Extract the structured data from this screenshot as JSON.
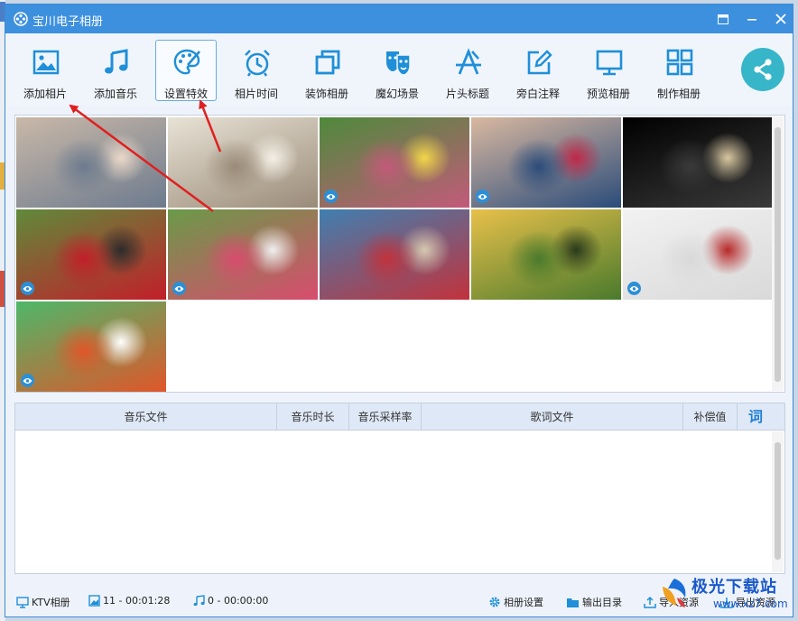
{
  "window": {
    "title": "宝川电子相册"
  },
  "toolbar": {
    "items": [
      {
        "label": "添加相片",
        "icon": "image-icon"
      },
      {
        "label": "添加音乐",
        "icon": "music-note-icon"
      },
      {
        "label": "设置特效",
        "icon": "palette-icon",
        "active": true
      },
      {
        "label": "相片时间",
        "icon": "alarm-clock-icon"
      },
      {
        "label": "装饰相册",
        "icon": "layers-icon"
      },
      {
        "label": "魔幻场景",
        "icon": "theater-mask-icon"
      },
      {
        "label": "片头标题",
        "icon": "title-a-icon"
      },
      {
        "label": "旁白注释",
        "icon": "edit-note-icon"
      },
      {
        "label": "预览相册",
        "icon": "monitor-icon"
      },
      {
        "label": "制作相册",
        "icon": "grid-icon"
      }
    ],
    "share_icon": "share-icon",
    "accent": "#1f8fd8"
  },
  "photos": {
    "count": 11,
    "items": [
      {
        "colors": [
          "#c9b8a8",
          "#6d7b8e",
          "#e9d8c8"
        ],
        "eye": false
      },
      {
        "colors": [
          "#e8e2d6",
          "#9a8b78",
          "#f4efe6"
        ],
        "eye": false
      },
      {
        "colors": [
          "#4e8a3c",
          "#c35a7a",
          "#f2d64a"
        ],
        "eye": true
      },
      {
        "colors": [
          "#d9b8a0",
          "#2b4c7a",
          "#c02848"
        ],
        "eye": true
      },
      {
        "colors": [
          "#000000",
          "#3a3a3a",
          "#d8c7a0"
        ],
        "eye": false
      },
      {
        "colors": [
          "#5f8a3a",
          "#c21f2a",
          "#2c2c2c"
        ],
        "eye": true
      },
      {
        "colors": [
          "#6a9a48",
          "#d84c6e",
          "#f0f0f0"
        ],
        "eye": true
      },
      {
        "colors": [
          "#3f7fb0",
          "#c2323c",
          "#d6c8b0"
        ],
        "eye": false
      },
      {
        "colors": [
          "#e8c04a",
          "#4a7a2c",
          "#2a3a1c"
        ],
        "eye": false
      },
      {
        "colors": [
          "#f2f2f2",
          "#d9d9d9",
          "#b82a2a"
        ],
        "eye": true
      },
      {
        "colors": [
          "#4db86a",
          "#e0562a",
          "#ffffff"
        ],
        "eye": true
      }
    ]
  },
  "music_table": {
    "columns": [
      "音乐文件",
      "音乐时长",
      "音乐采样率",
      "歌词文件",
      "补偿值"
    ],
    "lyric_button": "词",
    "rows": []
  },
  "statusbar": {
    "ktv": "KTV相册",
    "photos": "11 - 00:01:28",
    "music": "0 - 00:00:00",
    "album_settings": "相册设置",
    "output_dir": "输出目录",
    "import": "导入资源",
    "export": "导出资源"
  },
  "watermark": {
    "text": "极光下载站",
    "url": "www.xz7.com"
  }
}
